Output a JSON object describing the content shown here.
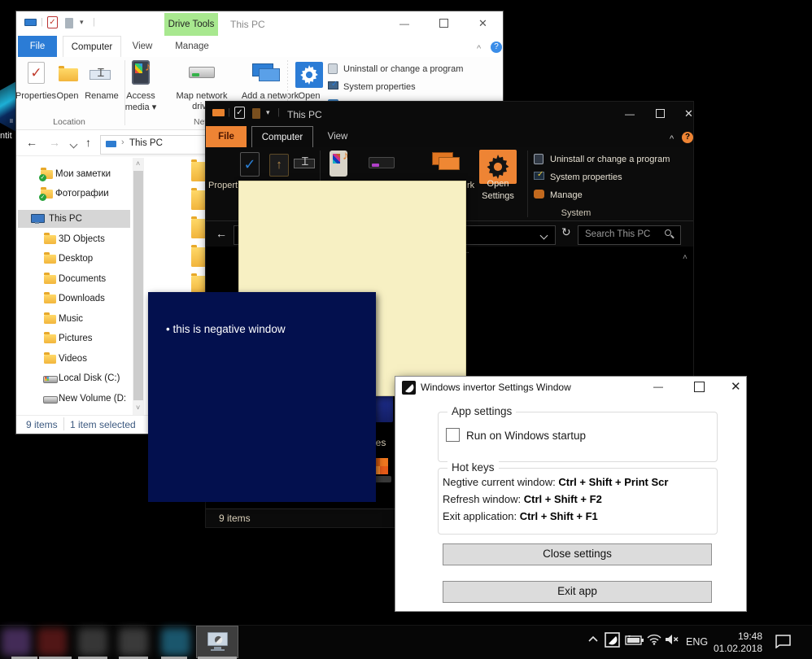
{
  "colors": {
    "accent_orange": "#ee8434",
    "negative_navy": "#03104e",
    "note_yellow": "#f7f0c3",
    "file_tab_blue": "#2b7cd6",
    "drive_tools_green": "#a8e88f",
    "status_text_blue": "#3d5a80",
    "inverted_text_tan": "#d9cfb9"
  },
  "glyphs": {
    "back": "←",
    "forward": "→",
    "up": "↑",
    "dropdown": "▾",
    "refresh": "↻",
    "collapse": "^",
    "help": "?",
    "minimize": "—",
    "close": "✕",
    "crumb_sep": "›",
    "scroll_up": "˄",
    "scroll_down": "˅",
    "bullet": "•",
    "check": "✓",
    "note": "♪"
  },
  "desktop": {
    "icon_label_fragment": "ntit",
    "small_fragment": "II"
  },
  "light_explorer": {
    "title": "This PC",
    "drive_tools_label": "Drive Tools",
    "tabs": [
      {
        "label": "File"
      },
      {
        "label": "Computer"
      },
      {
        "label": "View"
      },
      {
        "label": "Manage"
      }
    ],
    "ribbon": {
      "properties": "Properties",
      "open": "Open",
      "rename": "Rename",
      "access_media_l1": "Access",
      "access_media_l2": "media ▾",
      "map_network_l1": "Map network",
      "map_network_l2": "drive",
      "add_network": "Add a network",
      "open_settings": "Open",
      "uninstall": "Uninstall or change a program",
      "system_properties": "System properties",
      "group_location": "Location",
      "group_network": "Network"
    },
    "nav": {
      "breadcrumb": "This PC"
    },
    "sidebar": {
      "items": [
        {
          "label": "Мои заметки"
        },
        {
          "label": "Фотографии"
        },
        {
          "label": "This PC"
        },
        {
          "label": "3D Objects"
        },
        {
          "label": "Desktop"
        },
        {
          "label": "Documents"
        },
        {
          "label": "Downloads"
        },
        {
          "label": "Music"
        },
        {
          "label": "Pictures"
        },
        {
          "label": "Videos"
        },
        {
          "label": "Local Disk (C:)"
        },
        {
          "label": "New Volume (D:"
        }
      ]
    },
    "status": {
      "items": "9 items",
      "selected": "1 item selected"
    }
  },
  "dark_explorer": {
    "title": "This PC",
    "tabs": [
      {
        "label": "File"
      },
      {
        "label": "Computer"
      },
      {
        "label": "View"
      }
    ],
    "ribbon": {
      "properties_fragment": "Propert",
      "network_fragment": "rk",
      "open_settings_l1": "Open",
      "open_settings_l2": "Settings",
      "uninstall": "Uninstall or change a program",
      "system_properties": "System properties",
      "manage": "Manage",
      "group_system": "System"
    },
    "search_placeholder": "Search This PC",
    "content_fragment": "ices",
    "status_items": "9 items"
  },
  "negative_window": {
    "bullet": "•",
    "text": "this is negative window"
  },
  "settings_window": {
    "title": "Windows invertor Settings Window",
    "app_settings": {
      "legend": "App settings",
      "checkbox_label": "Run on Windows startup",
      "checked": false
    },
    "hot_keys": {
      "legend": "Hot keys",
      "rows": [
        {
          "action": "Negtive current window:",
          "keys": "Ctrl + Shift + Print Scr"
        },
        {
          "action": "Refresh window:",
          "keys": "Ctrl + Shift + F2"
        },
        {
          "action": "Exit application:",
          "keys": "Ctrl + Shift + F1"
        }
      ]
    },
    "buttons": {
      "close": "Close settings",
      "exit": "Exit app"
    }
  },
  "taskbar": {
    "tray": {
      "language": "ENG",
      "time": "19:48",
      "date": "01.02.2018"
    }
  }
}
